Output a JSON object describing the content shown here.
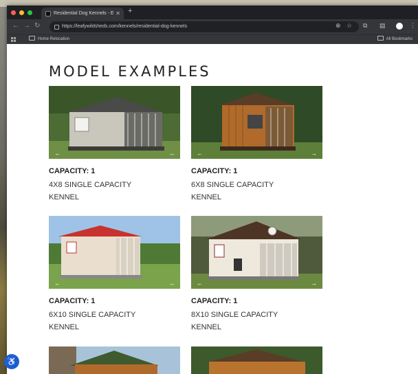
{
  "browser": {
    "tab_title": "Residential Dog Kennels - E",
    "url": "https://leafywildsheds.com/kennels/residential-dog-kennels",
    "bookmark_left": "Home Relocation",
    "bookmark_right": "All Bookmarks"
  },
  "page": {
    "heading": "MODEL EXAMPLES",
    "cards": [
      {
        "capacity": "CAPACITY: 1",
        "desc_line1": "4X8 SINGLE CAPACITY",
        "desc_line2": "KENNEL"
      },
      {
        "capacity": "CAPACITY: 1",
        "desc_line1": "6X8 SINGLE CAPACITY",
        "desc_line2": "KENNEL"
      },
      {
        "capacity": "CAPACITY: 1",
        "desc_line1": "6X10 SINGLE CAPACITY",
        "desc_line2": "KENNEL"
      },
      {
        "capacity": "CAPACITY: 1",
        "desc_line1": "8X10 SINGLE CAPACITY",
        "desc_line2": "KENNEL"
      }
    ]
  },
  "colors": {
    "accent_blue": "#1d5fd6",
    "roof_red": "#c8322f",
    "cedar": "#b06a2b"
  },
  "icons": [
    "back-icon",
    "forward-icon",
    "reload-icon",
    "star-icon",
    "extensions-icon",
    "accessibility-icon"
  ]
}
